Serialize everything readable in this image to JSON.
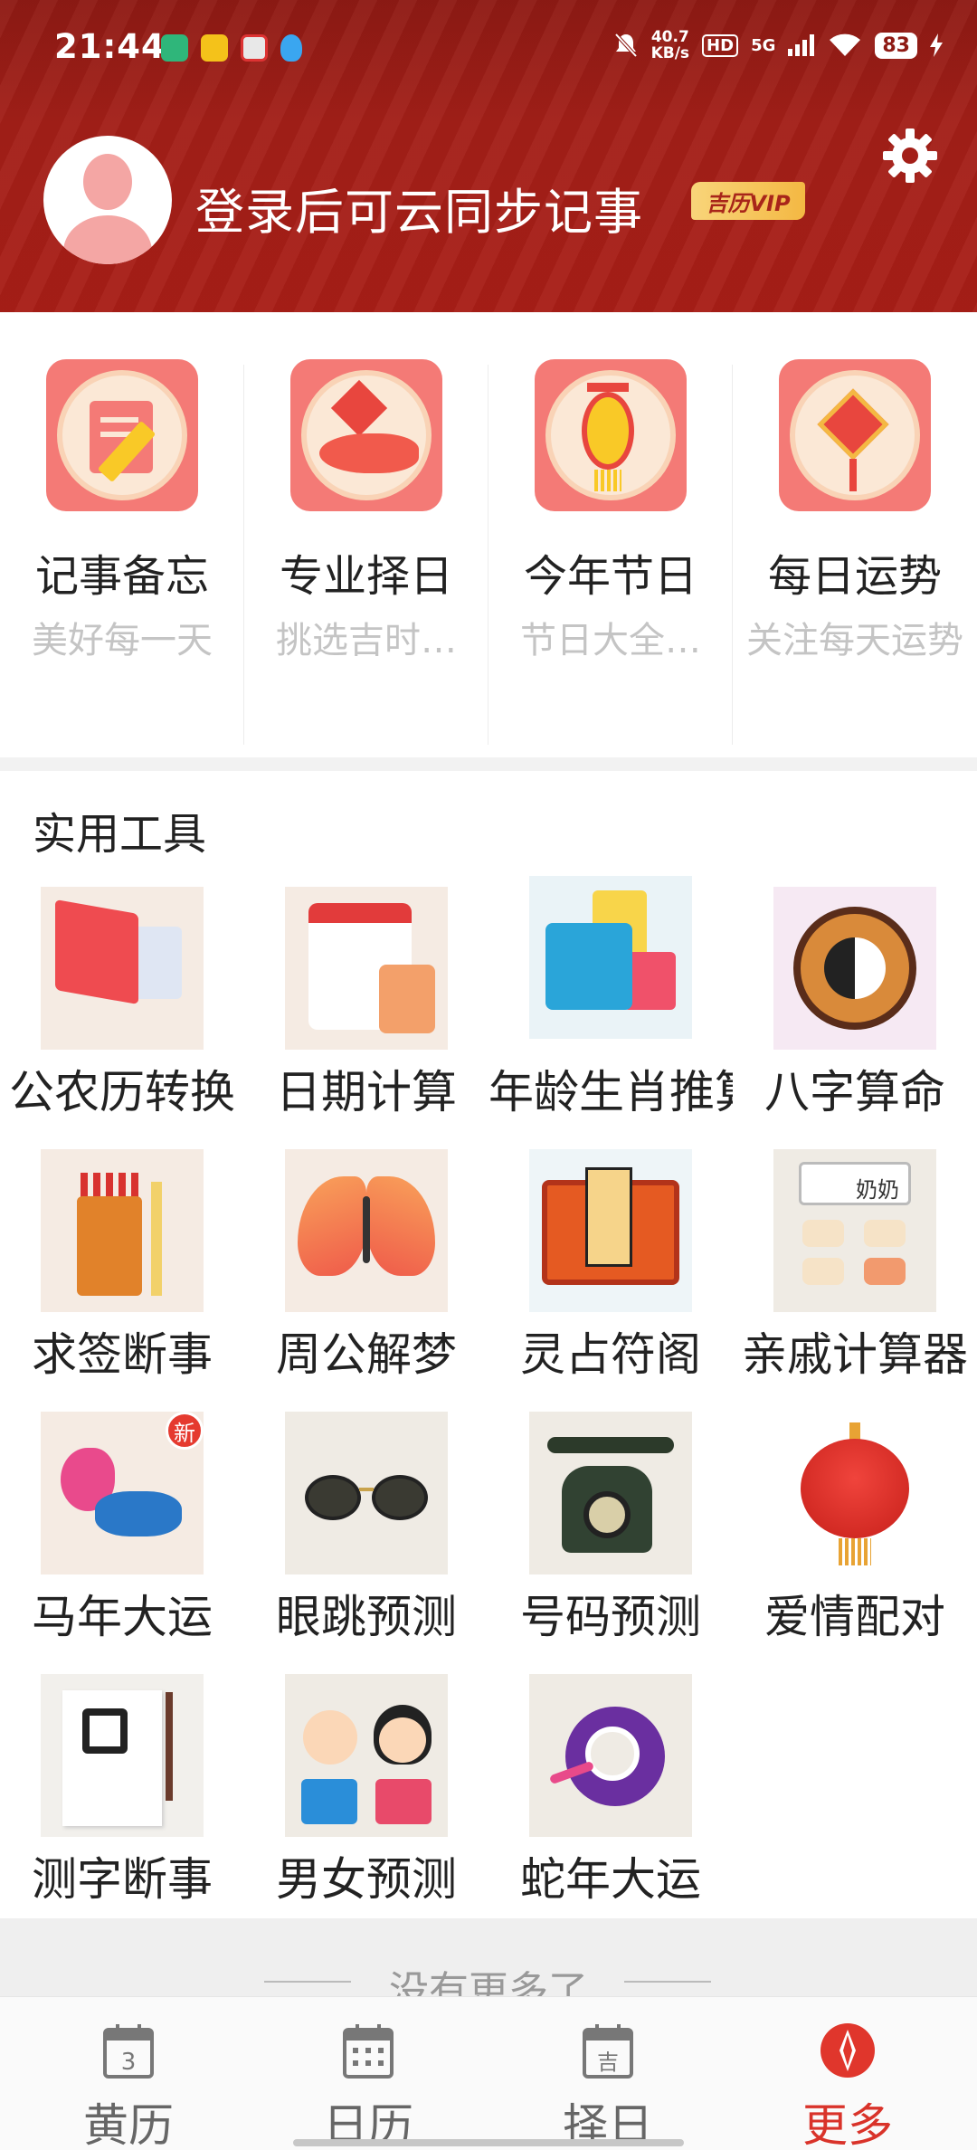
{
  "status": {
    "time": "21:44",
    "net_speed": "40.7",
    "net_unit": "KB/s",
    "hd": "HD",
    "signal": "5G",
    "battery": "83"
  },
  "header": {
    "login_text": "登录后可云同步记事",
    "vip_badge": "吉历VIP"
  },
  "quick": [
    {
      "title": "记事备忘",
      "sub": "美好每一天",
      "icon": "notepad-pencil-icon"
    },
    {
      "title": "专业择日",
      "sub": "挑选吉时…",
      "icon": "fish-seal-icon"
    },
    {
      "title": "今年节日",
      "sub": "节日大全…",
      "icon": "lantern-icon"
    },
    {
      "title": "每日运势",
      "sub": "关注每天运势",
      "icon": "fu-knot-icon"
    }
  ],
  "tools": {
    "title": "实用工具",
    "items": [
      {
        "label": "公农历转换",
        "icon": "calendar-convert-icon"
      },
      {
        "label": "日期计算",
        "icon": "calendar-30-calculator-icon"
      },
      {
        "label": "年龄生肖推算",
        "icon": "dragon-age-card-icon"
      },
      {
        "label": "八字算命",
        "icon": "yin-yang-bagua-icon"
      },
      {
        "label": "求签断事",
        "icon": "fortune-sticks-icon"
      },
      {
        "label": "周公解梦",
        "icon": "butterfly-icon"
      },
      {
        "label": "灵占符阁",
        "icon": "talisman-icon"
      },
      {
        "label": "亲戚计算器",
        "icon": "relatives-calculator-icon"
      },
      {
        "label": "马年大运",
        "icon": "horse-icon",
        "badge": "新"
      },
      {
        "label": "眼跳预测",
        "icon": "glasses-icon"
      },
      {
        "label": "号码预测",
        "icon": "rotary-phone-icon"
      },
      {
        "label": "爱情配对",
        "icon": "double-happiness-lantern-icon"
      },
      {
        "label": "测字断事",
        "icon": "calligraphy-brush-icon"
      },
      {
        "label": "男女预测",
        "icon": "boy-girl-icon"
      },
      {
        "label": "蛇年大运",
        "icon": "snake-icon"
      }
    ],
    "calc_display": "奶奶"
  },
  "end_note": "没有更多了",
  "tabbar": [
    {
      "label": "黄历",
      "icon": "almanac-3-icon",
      "active": false,
      "icon_text": "3"
    },
    {
      "label": "日历",
      "icon": "calendar-grid-icon",
      "active": false
    },
    {
      "label": "择日",
      "icon": "calendar-ji-icon",
      "active": false,
      "icon_text": "吉"
    },
    {
      "label": "更多",
      "icon": "compass-more-icon",
      "active": true
    }
  ],
  "colors": {
    "header_red": "#a31f18",
    "accent_red": "#d9332a",
    "quick_icon_bg": "#f47a76",
    "vip_gold": "#f4b843"
  }
}
